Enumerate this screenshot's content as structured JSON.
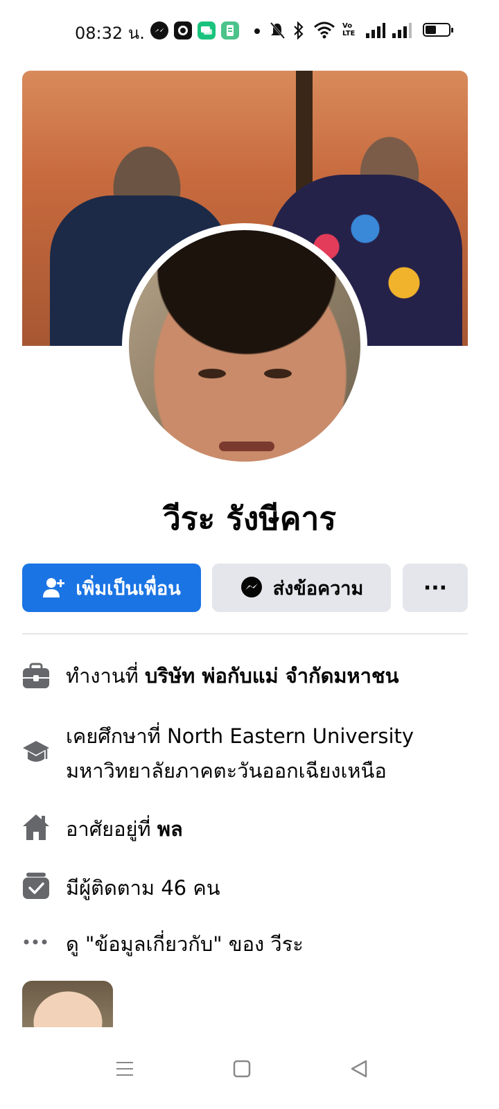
{
  "status_bar": {
    "time": "08:32 น.",
    "icons": [
      "messenger-icon",
      "app-icon",
      "chat-icon",
      "app-icon-green",
      "dot-icon",
      "mute-icon",
      "bluetooth-icon",
      "wifi-icon",
      "volte-icon",
      "signal-icon",
      "signal-icon-2",
      "battery-icon"
    ],
    "volte_label": "Vo LTE"
  },
  "profile": {
    "name": "วีระ รังษีคาร"
  },
  "actions": {
    "add_friend_label": "เพิ่มเป็นเพื่อน",
    "message_label": "ส่งข้อความ",
    "more_label": "···"
  },
  "info": {
    "work_prefix": "ทำงานที่",
    "work_place": "บริษัท พ่อกับแม่ จำกัดมหาชน",
    "education_line1": "เคยศึกษาที่ North Eastern University",
    "education_line2": "มหาวิทยาลัยภาคตะวันออกเฉียงเหนือ",
    "lives_prefix": "อาศัยอยู่ที่",
    "lives_place": "พล",
    "followers_text": "มีผู้ติดตาม 46 คน",
    "about_link": "ดู \"ข้อมูลเกี่ยวกับ\" ของ วีระ"
  },
  "colors": {
    "primary": "#1b74e4",
    "button_secondary": "#e4e6eb",
    "icon_gray": "#65676b"
  }
}
